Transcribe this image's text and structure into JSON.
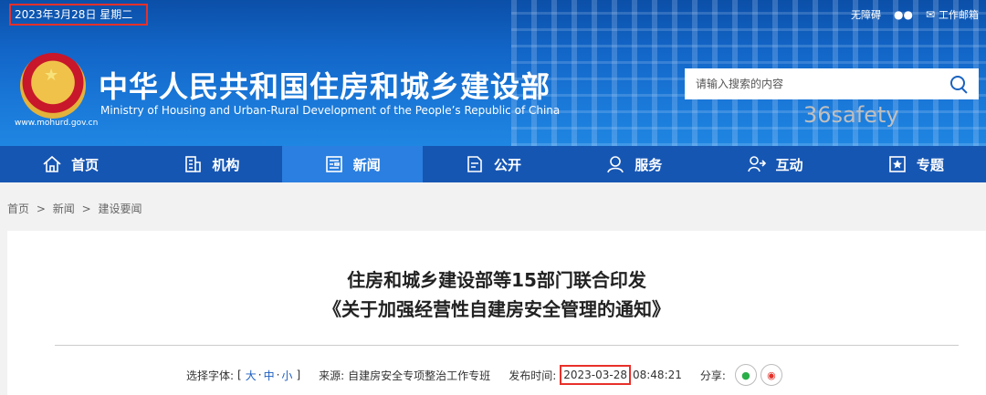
{
  "topbar": {
    "date": "2023年3月28日 星期二",
    "accessibility": "无障碍",
    "mail": "工作邮箱"
  },
  "brand": {
    "title_cn": "中华人民共和国住房和城乡建设部",
    "title_en": "Ministry of Housing and Urban-Rural Development of the People’s Republic of China",
    "url": "www.mohurd.gov.cn"
  },
  "search": {
    "placeholder": "请输入搜索的内容"
  },
  "nav": {
    "items": [
      {
        "label": "首页",
        "icon": "home-icon"
      },
      {
        "label": "机构",
        "icon": "building-icon"
      },
      {
        "label": "新闻",
        "icon": "newspaper-icon"
      },
      {
        "label": "公开",
        "icon": "document-icon"
      },
      {
        "label": "服务",
        "icon": "service-icon"
      },
      {
        "label": "互动",
        "icon": "interaction-icon"
      },
      {
        "label": "专题",
        "icon": "star-icon"
      }
    ],
    "active_index": 2
  },
  "breadcrumb": [
    "首页",
    ">",
    "新闻",
    ">",
    "建设要闻"
  ],
  "article": {
    "title_line1": "住房和城乡建设部等15部门联合印发",
    "title_line2": "《关于加强经营性自建房安全管理的通知》",
    "font_size_label": "选择字体:",
    "bracket_open": "[",
    "size_large": "大",
    "sep1": "·",
    "size_medium": "中",
    "sep2": "·",
    "size_small": "小",
    "bracket_close": "]",
    "source_label": "来源:",
    "source_value": "自建房安全专项整治工作专班",
    "publish_label": "发布时间:",
    "publish_date": "2023-03-28",
    "publish_time": "08:48:21",
    "share_label": "分享:"
  },
  "watermark": "36safety",
  "colors": {
    "header_blue": "#1266c8",
    "nav_blue": "#1656b3",
    "nav_active": "#2b7fe0",
    "highlight_red": "#e8302a",
    "link_blue": "#1d5fc0"
  }
}
